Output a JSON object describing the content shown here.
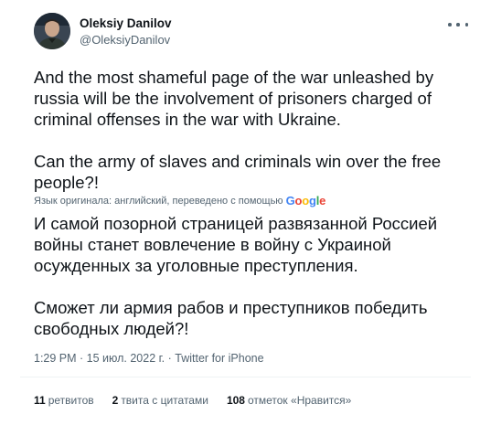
{
  "author": {
    "name": "Oleksiy Danilov",
    "handle": "@OleksiyDanilov",
    "avatar_icon": "profile-photo"
  },
  "tweet": {
    "text_en": "And the most shameful page of the war unleashed by russia will be the involvement of prisoners charged of criminal offenses in the war with Ukraine.\n\nCan the army of slaves and criminals win over the free people?!",
    "translation_note": "Язык оригинала: английский, переведено с помощью",
    "translation_provider": "Google",
    "text_ru": "И самой позорной страницей развязанной Россией войны станет вовлечение в войну с Украиной осужденных за уголовные преступления.\n\n Сможет ли армия рабов и преступников победить свободных людей?!",
    "timestamp": "1:29 PM · 15 июл. 2022 г.",
    "source": "Twitter for iPhone"
  },
  "stats": {
    "retweets_count": "11",
    "retweets_label": "ретвитов",
    "quotes_count": "2",
    "quotes_label": "твита с цитатами",
    "likes_count": "108",
    "likes_label": "отметок «Нравится»"
  },
  "colors": {
    "text": "#0f1419",
    "secondary": "#536471",
    "divider": "#eff3f4",
    "google_blue": "#4285F4",
    "google_red": "#EA4335",
    "google_yellow": "#FBBC05",
    "google_green": "#34A853"
  }
}
